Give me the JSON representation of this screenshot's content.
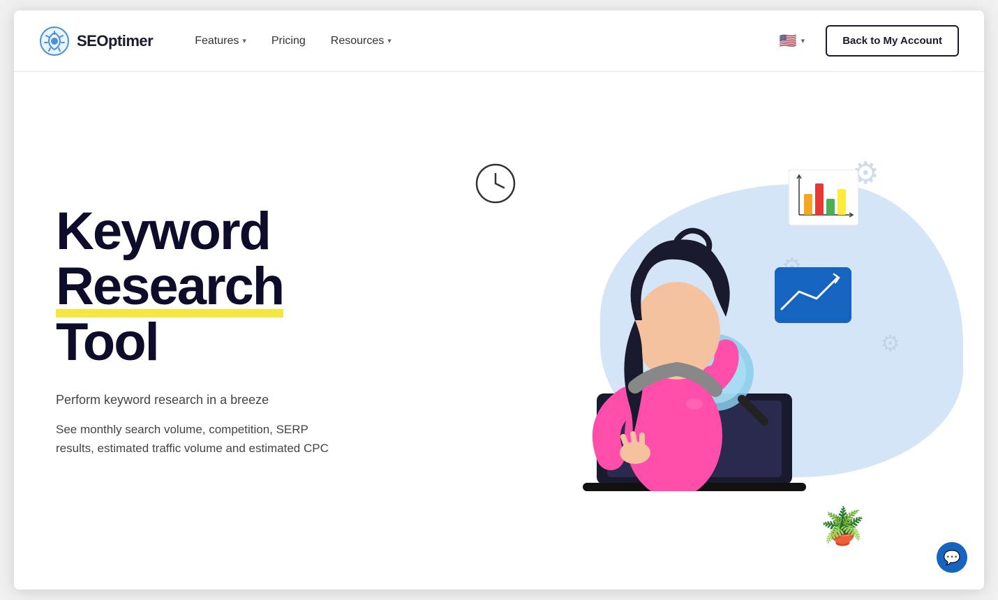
{
  "brand": {
    "name": "SEOptimer",
    "logo_alt": "SEOptimer logo"
  },
  "nav": {
    "links": [
      {
        "label": "Features",
        "has_dropdown": true
      },
      {
        "label": "Pricing",
        "has_dropdown": false
      },
      {
        "label": "Resources",
        "has_dropdown": true
      }
    ],
    "flag_label": "EN",
    "back_button_label": "Back to My Account"
  },
  "hero": {
    "title_line1": "Keyword",
    "title_line2": "Research",
    "title_line3": "Tool",
    "subtitle": "Perform keyword research in a breeze",
    "description": "See monthly search volume, competition, SERP results, estimated traffic volume and estimated CPC"
  },
  "chat": {
    "icon": "💬"
  }
}
